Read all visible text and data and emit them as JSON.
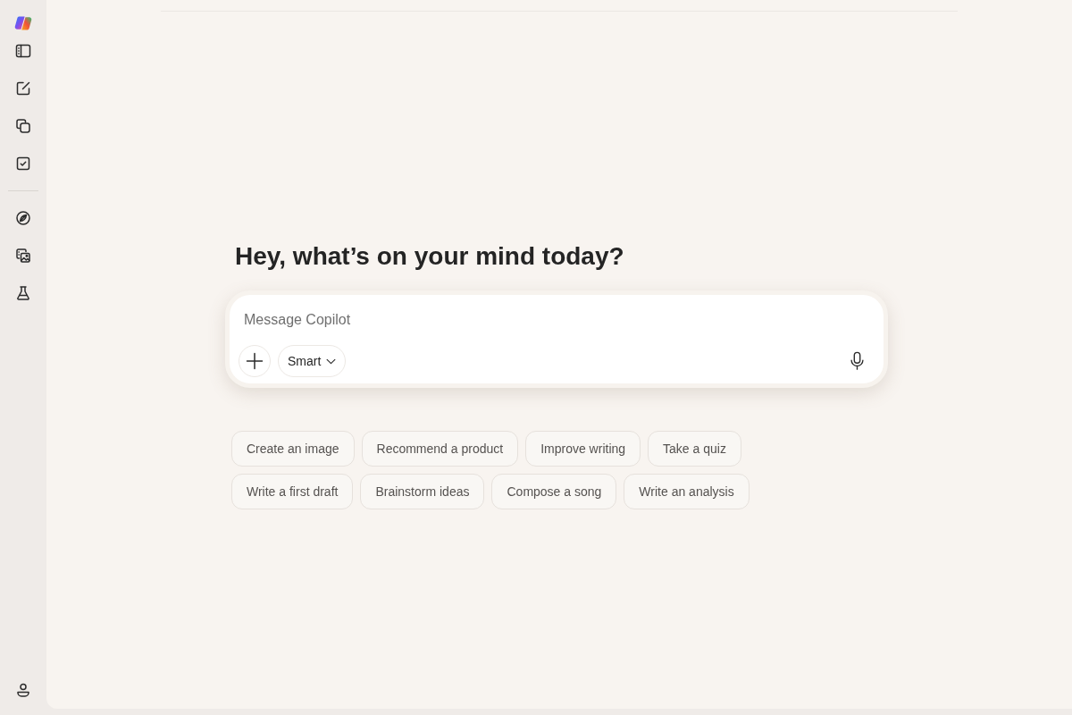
{
  "heading": "Hey, what’s on your mind today?",
  "composer": {
    "placeholder": "Message Copilot",
    "mode_button": "Smart"
  },
  "suggestion_rows": [
    [
      "Create an image",
      "Recommend a product",
      "Improve writing",
      "Take a quiz"
    ],
    [
      "Write a first draft",
      "Brainstorm ideas",
      "Compose a song",
      "Write an analysis"
    ]
  ]
}
